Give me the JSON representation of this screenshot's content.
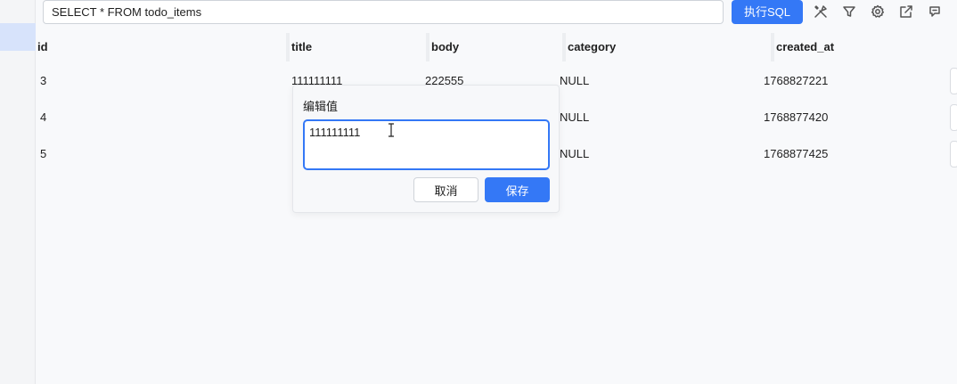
{
  "toolbar": {
    "sql_query": "SELECT * FROM todo_items",
    "run_label": "执行SQL",
    "icons": [
      "tools-icon",
      "filter-icon",
      "settings-icon",
      "export-icon",
      "comment-icon"
    ]
  },
  "table": {
    "columns": [
      "id",
      "title",
      "body",
      "category",
      "created_at"
    ],
    "rows": [
      {
        "id": "3",
        "title": "111111111",
        "body": "222555",
        "category": "NULL",
        "created_at": "1768827221"
      },
      {
        "id": "4",
        "title": "",
        "body": "",
        "category": "NULL",
        "created_at": "1768877420"
      },
      {
        "id": "5",
        "title": "",
        "body": "",
        "category": "NULL",
        "created_at": "1768877425"
      }
    ]
  },
  "editor": {
    "title": "编辑值",
    "value": "111111111",
    "cancel_label": "取消",
    "save_label": "保存"
  },
  "colors": {
    "accent": "#3478f6",
    "sidebar_selected": "#d7e3fb"
  }
}
